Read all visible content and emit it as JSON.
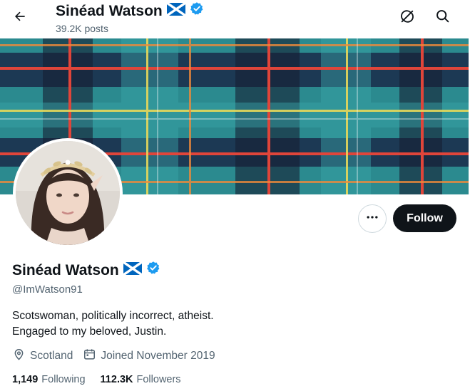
{
  "header": {
    "name": "Sinéad Watson",
    "posts": "39.2K posts"
  },
  "profile": {
    "name": "Sinéad Watson",
    "handle": "@ImWatson91",
    "bio_line1": "Scotswoman, politically incorrect, atheist.",
    "bio_line2": "Engaged to my beloved, Justin.",
    "location": "Scotland",
    "joined": "Joined November 2019",
    "following_count": "1,149",
    "following_label": "Following",
    "followers_count": "112.3K",
    "followers_label": "Followers"
  },
  "actions": {
    "follow_label": "Follow"
  },
  "icons": {
    "back": "arrow-left-icon",
    "grok": "grok-icon",
    "search": "search-icon",
    "more": "more-horizontal-icon",
    "verified": "verified-badge-icon",
    "flag": "scotland-flag-icon",
    "location": "location-pin-icon",
    "calendar": "calendar-icon"
  },
  "colors": {
    "verified_blue": "#1d9bf0",
    "follow_button_bg": "#0f1419",
    "secondary_text": "#536471",
    "flag_blue": "#0065bd",
    "banner_teal": "#2d8a8e"
  }
}
